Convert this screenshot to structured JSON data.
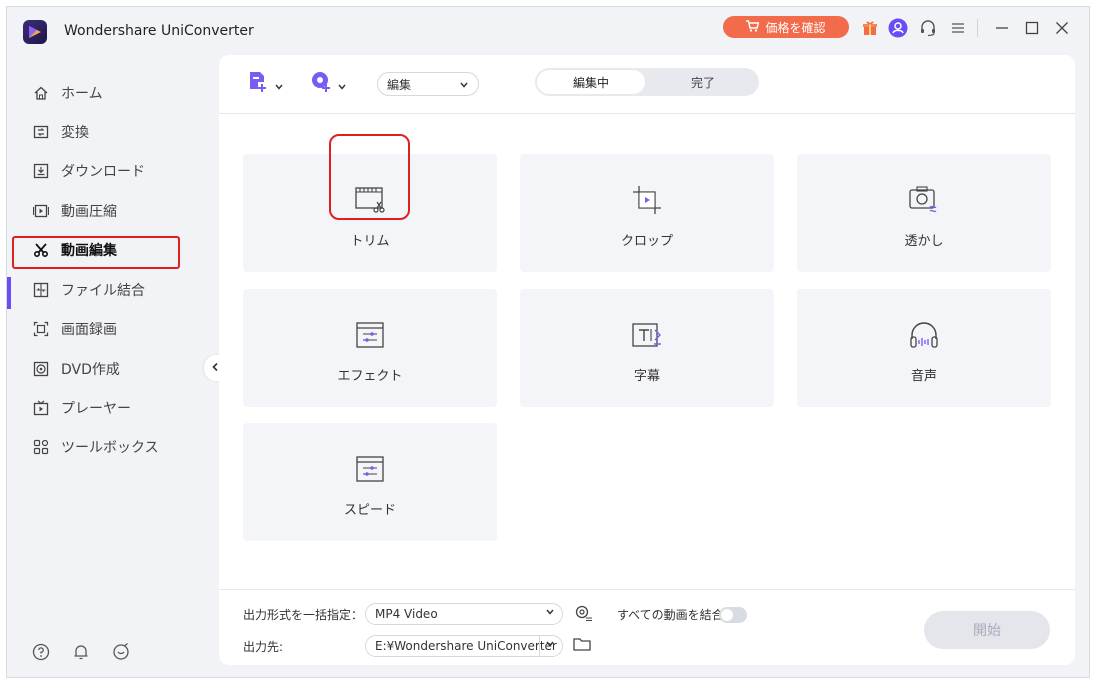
{
  "app": {
    "title": "Wondershare UniConverter"
  },
  "titlebar": {
    "price_label": "価格を確認"
  },
  "sidebar": {
    "items": [
      {
        "label": "ホーム",
        "icon": "home-icon"
      },
      {
        "label": "変換",
        "icon": "convert-icon"
      },
      {
        "label": "ダウンロード",
        "icon": "download-icon"
      },
      {
        "label": "動画圧縮",
        "icon": "compress-icon"
      },
      {
        "label": "動画編集",
        "icon": "scissors-icon",
        "active": true
      },
      {
        "label": "ファイル結合",
        "icon": "merge-icon"
      },
      {
        "label": "画面録画",
        "icon": "screen-record-icon"
      },
      {
        "label": "DVD作成",
        "icon": "dvd-icon"
      },
      {
        "label": "プレーヤー",
        "icon": "player-icon"
      },
      {
        "label": "ツールボックス",
        "icon": "toolbox-icon"
      }
    ]
  },
  "toolbar": {
    "mode_select": "編集",
    "tabs": {
      "editing": "編集中",
      "done": "完了"
    }
  },
  "cards": [
    {
      "label": "トリム",
      "icon": "trim-icon"
    },
    {
      "label": "クロップ",
      "icon": "crop-icon"
    },
    {
      "label": "透かし",
      "icon": "watermark-icon"
    },
    {
      "label": "エフェクト",
      "icon": "effect-icon"
    },
    {
      "label": "字幕",
      "icon": "subtitle-icon"
    },
    {
      "label": "音声",
      "icon": "audio-icon"
    },
    {
      "label": "スピード",
      "icon": "speed-icon"
    }
  ],
  "footer": {
    "format_label": "出力形式を一括指定：",
    "format_value": "MP4 Video",
    "merge_label": "すべての動画を結合",
    "output_label": "出力先:",
    "output_value": "E:¥Wondershare UniConverter",
    "start_label": "開始"
  },
  "colors": {
    "accent": "#6a4ef5",
    "price": "#f26b4b",
    "highlight": "#e02020"
  }
}
